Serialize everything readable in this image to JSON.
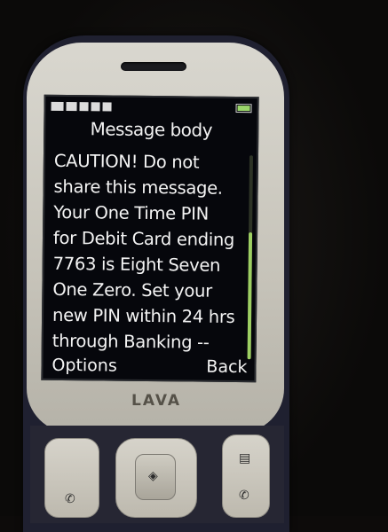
{
  "screen": {
    "title": "Message body",
    "message_lines": [
      "CAUTION! Do not",
      "share this message.",
      "Your One Time PIN",
      "for Debit Card ending",
      "7763 is Eight Seven",
      "One Zero. Set your",
      "new PIN within 24 hrs",
      "through Banking --"
    ],
    "left_softkey": "Options",
    "right_softkey": "Back",
    "scroll_fraction": 0.62
  },
  "device": {
    "brand": "LAVA"
  },
  "colors": {
    "screen_bg": "#06070c",
    "text": "#f4f4f4",
    "scrollbar_accent": "#9dcf63",
    "bezel": "#c6c3b9",
    "body": "#1f2030"
  }
}
